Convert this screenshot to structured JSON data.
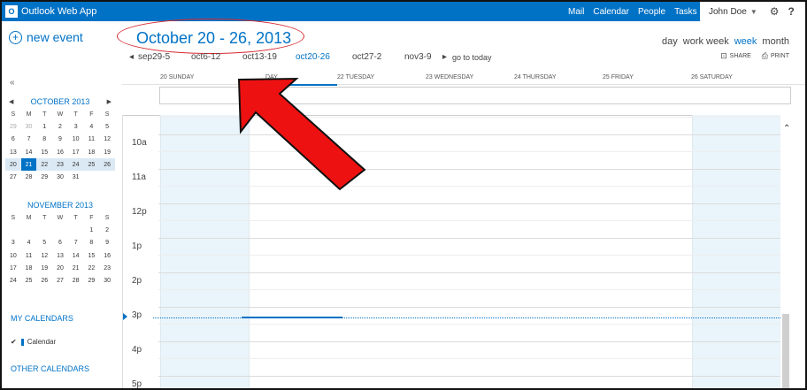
{
  "app": {
    "title": "Outlook Web App",
    "logo_letter": "O"
  },
  "topnav": {
    "items": [
      {
        "label": "Mail",
        "active": false
      },
      {
        "label": "Calendar",
        "active": true
      },
      {
        "label": "People",
        "active": false
      },
      {
        "label": "Tasks",
        "active": false
      }
    ],
    "user_name": "John Doe",
    "gear_icon": "⚙",
    "help_label": "?"
  },
  "sidebar": {
    "new_event_label": "new event",
    "collapse_label": "«",
    "october": {
      "title": "OCTOBER 2013",
      "dow": [
        "S",
        "M",
        "T",
        "W",
        "T",
        "F",
        "S"
      ],
      "weeks": [
        [
          "29",
          "30",
          "1",
          "2",
          "3",
          "4",
          "5"
        ],
        [
          "6",
          "7",
          "8",
          "9",
          "10",
          "11",
          "12"
        ],
        [
          "13",
          "14",
          "15",
          "16",
          "17",
          "18",
          "19"
        ],
        [
          "20",
          "21",
          "22",
          "23",
          "24",
          "25",
          "26"
        ],
        [
          "27",
          "28",
          "29",
          "30",
          "31",
          "",
          ""
        ]
      ]
    },
    "november": {
      "title": "NOVEMBER 2013",
      "dow": [
        "S",
        "M",
        "T",
        "W",
        "T",
        "F",
        "S"
      ],
      "weeks": [
        [
          "",
          "",
          "",
          "",
          "",
          "1",
          "2"
        ],
        [
          "3",
          "4",
          "5",
          "6",
          "7",
          "8",
          "9"
        ],
        [
          "10",
          "11",
          "12",
          "13",
          "14",
          "15",
          "16"
        ],
        [
          "17",
          "18",
          "19",
          "20",
          "21",
          "22",
          "23"
        ],
        [
          "24",
          "25",
          "26",
          "27",
          "28",
          "29",
          "30"
        ]
      ]
    },
    "my_calendars_label": "MY CALENDARS",
    "calendar_item_label": "Calendar",
    "other_calendars_label": "OTHER CALENDARS"
  },
  "header": {
    "date_range": "October 20 - 26, 2013",
    "week_nav": {
      "prev_arrow": "◂",
      "next_arrow": "▸",
      "weeks": [
        "sep29-5",
        "oct6-12",
        "oct13-19",
        "oct20-26",
        "oct27-2",
        "nov3-9"
      ],
      "go_to_today": "go to today"
    },
    "views": [
      {
        "label": "day",
        "active": false
      },
      {
        "label": "work week",
        "active": false
      },
      {
        "label": "week",
        "active": true
      },
      {
        "label": "month",
        "active": false
      }
    ],
    "share_label": "SHARE",
    "print_label": "PRINT"
  },
  "day_headers": [
    "20 SUNDAY",
    "DAY",
    "22 TUESDAY",
    "23 WEDNESDAY",
    "24 THURSDAY",
    "25 FRIDAY",
    "26 SATURDAY"
  ],
  "time_labels": [
    "10a",
    "11a",
    "12p",
    "1p",
    "2p",
    "3p",
    "4p",
    "5p"
  ],
  "colors": {
    "accent": "#0072c6",
    "annotation_red": "#ee1111",
    "weekend_shade": "#eaf4fb"
  }
}
